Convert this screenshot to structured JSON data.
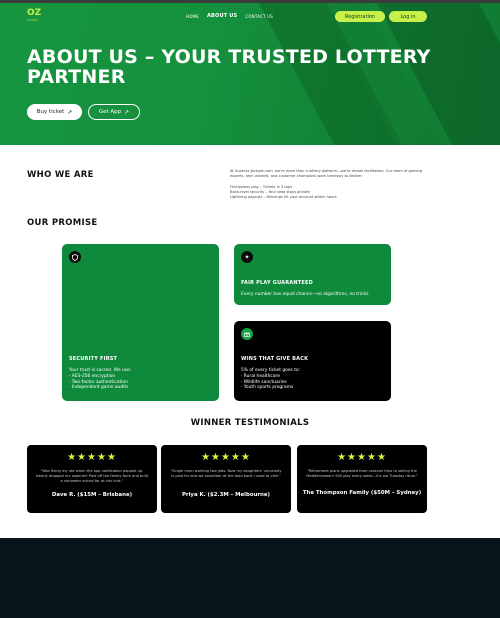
{
  "header": {
    "logo_text": "OZ",
    "logo_sub": "LOTTO",
    "nav": [
      "Home",
      "About Us",
      "Contact Us"
    ],
    "register_label": "Registration",
    "login_label": "Log in"
  },
  "hero": {
    "title": "ABOUT US – YOUR TRUSTED LOTTERY PARTNER",
    "buy_ticket_label": "Buy ticket",
    "get_app_label": "Get App"
  },
  "who": {
    "heading": "WHO WE ARE",
    "intro": "At Superoz.Jackpot.com, we're more than a lottery platform—we're dream facilitators. Our team of gaming experts, tech wizards, and customer champions work tirelessly to deliver:",
    "items": [
      "Frictionless play – Tickets in 3 taps",
      "Bank-level security – Your data stays private",
      "Lightning payouts – Winnings hit your account within hours"
    ]
  },
  "promise": {
    "heading": "OUR PROMISE",
    "security": {
      "icon": "shield-icon",
      "title": "SECURITY FIRST",
      "lead": "Your trust is sacred. We use:",
      "items": [
        "· AES-256 encryption",
        "· Two-factor authentication",
        "· Independent game audits"
      ]
    },
    "fair": {
      "icon": "sparkle-icon",
      "title": "FAIR PLAY GUARANTEED",
      "text": "Every number has equal chance—no algorithms, no tricks."
    },
    "wins": {
      "icon": "gift-icon",
      "title": "WINS THAT GIVE BACK",
      "lead": "5% of every ticket goes to:",
      "items": [
        "· Rural healthcare",
        "· Wildlife sanctuaries",
        "· Youth sports programs"
      ]
    }
  },
  "testimonials": {
    "heading": "WINNER TESTIMONIALS",
    "stars": "★★★★★",
    "items": [
      {
        "quote": "\"Was fixing my ute when the app notification popped up. Nearly dropped my spanner! Paid off the family farm and built a rainwater school for at-risk kids.\"",
        "author": "Dave R. ($15M – Brisbane)"
      },
      {
        "quote": "\"Single mum working two jobs. Now my daughters' university is paid for and we volunteer at the food bank I used to visit.\"",
        "author": "Priya K. ($2.3M – Melbourne)"
      },
      {
        "quote": "\"Retirement plans upgraded from caravan trips to sailing the Mediterranean! Still play every week—it's our Tuesday ritual.\"",
        "author": "The Thompson Family ($50M – Sydney)"
      }
    ]
  },
  "colors": {
    "brand_green": "#0f8a3c",
    "accent_lime": "#c7f04a",
    "footer": "#07141a"
  }
}
